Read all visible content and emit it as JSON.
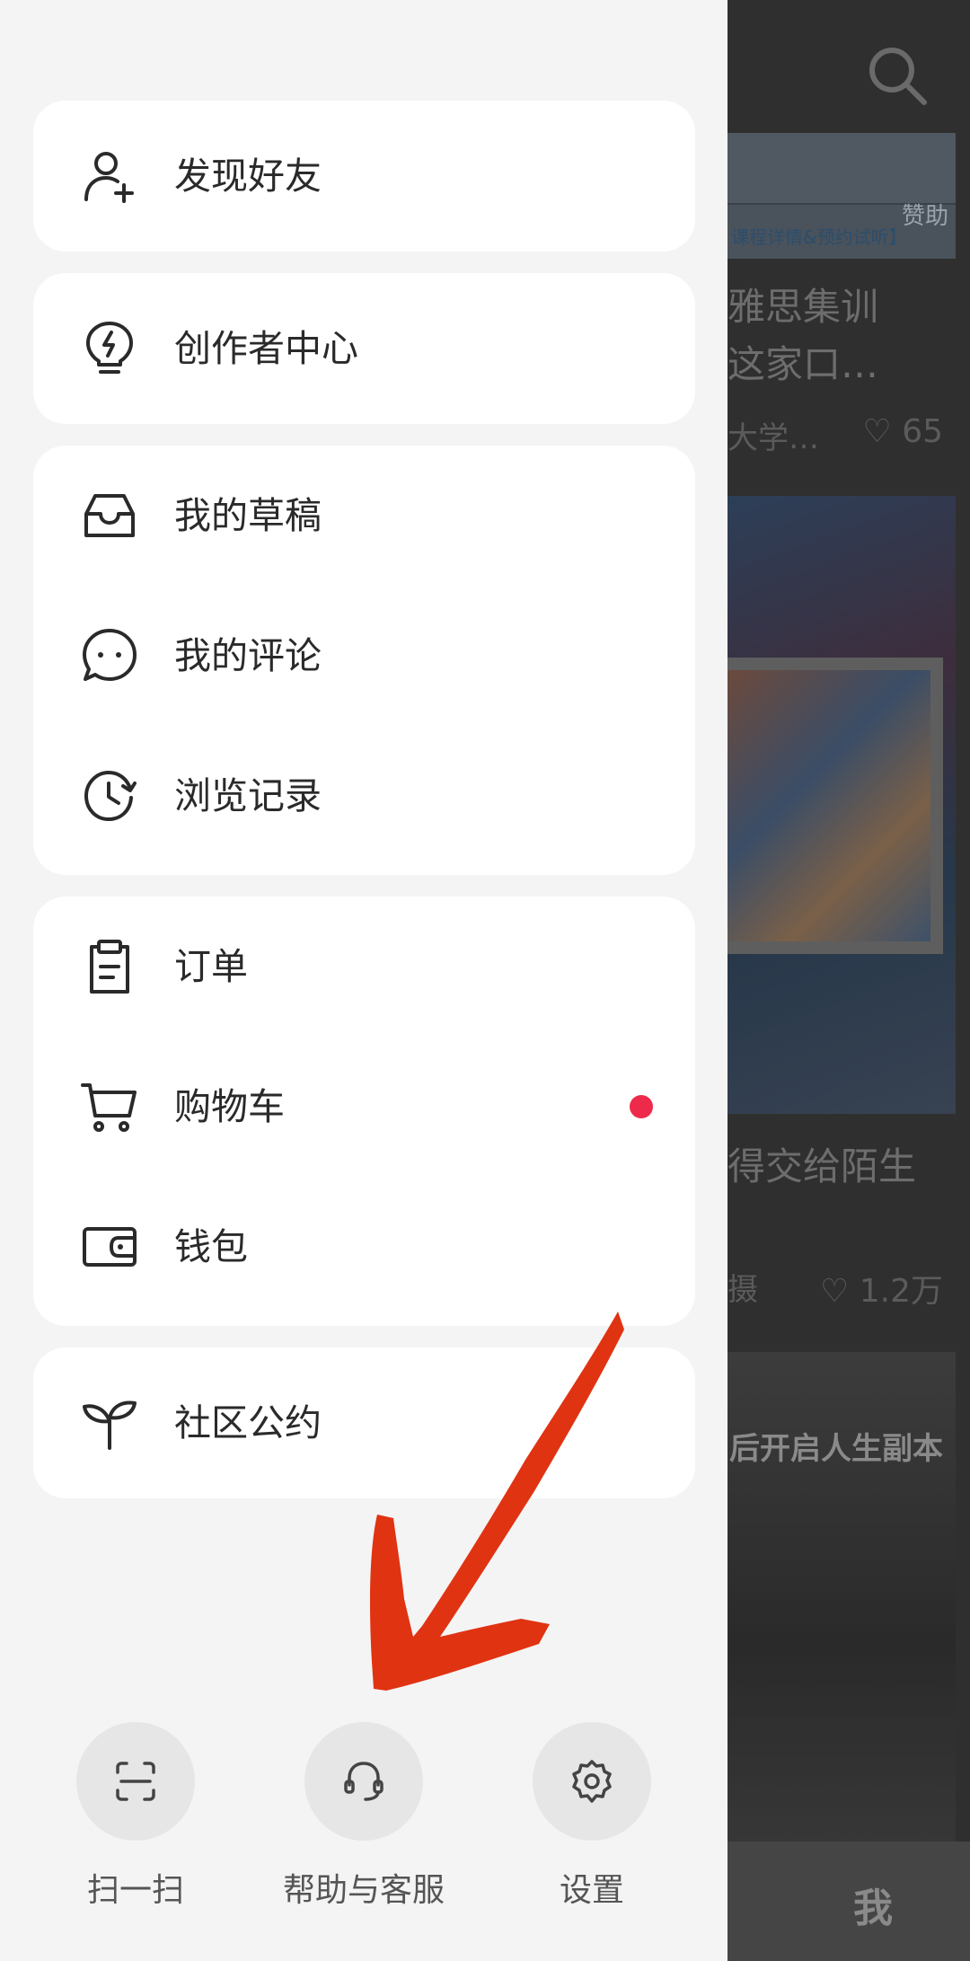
{
  "drawer": {
    "groups": [
      {
        "items": [
          {
            "label": "发现好友",
            "icon": "add-user-icon"
          }
        ]
      },
      {
        "items": [
          {
            "label": "创作者中心",
            "icon": "lightbulb-icon"
          }
        ]
      },
      {
        "items": [
          {
            "label": "我的草稿",
            "icon": "inbox-icon"
          },
          {
            "label": "我的评论",
            "icon": "chat-bubble-icon"
          },
          {
            "label": "浏览记录",
            "icon": "history-clock-icon"
          }
        ]
      },
      {
        "items": [
          {
            "label": "订单",
            "icon": "clipboard-icon"
          },
          {
            "label": "购物车",
            "icon": "cart-icon",
            "badge_dot": true
          },
          {
            "label": "钱包",
            "icon": "wallet-icon"
          }
        ]
      },
      {
        "items": [
          {
            "label": "社区公约",
            "icon": "sprout-icon"
          }
        ]
      }
    ],
    "bottom": [
      {
        "label": "扫一扫",
        "icon": "scan-icon"
      },
      {
        "label": "帮助与客服",
        "icon": "headset-icon"
      },
      {
        "label": "设置",
        "icon": "gear-icon"
      }
    ],
    "badge_color": "#ee2a4a"
  },
  "annotation": {
    "arrow_color": "#e03312"
  },
  "background_feed": {
    "ad_label": "赞助",
    "ad_caption": "课程详情&预约试听】",
    "post1_title": "雅思集训\n这家口…",
    "post1_author": "大学…",
    "post1_likes": "65",
    "post2_title": "得交给陌生",
    "post2_author": "摄",
    "post2_likes": "1.2万",
    "post3_caption": "后开启人生副本",
    "tab_me": "我"
  }
}
